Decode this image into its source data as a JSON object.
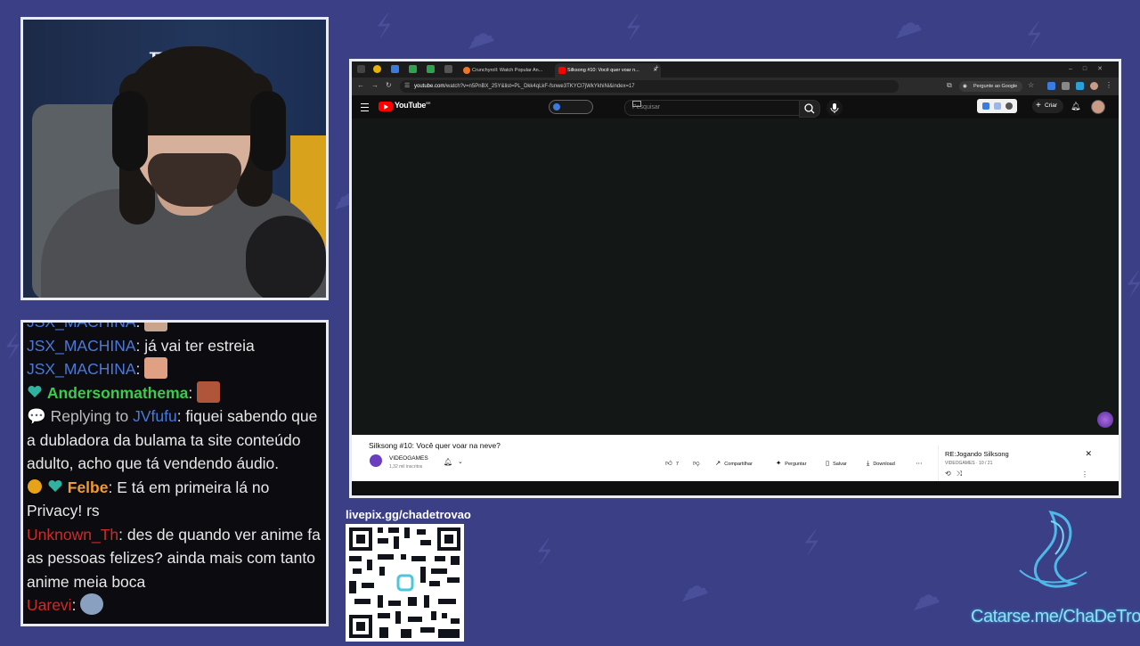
{
  "webcam": {
    "sign_text": "E: P"
  },
  "chat": {
    "lines": [
      {
        "user": "JSX_MACHINA",
        "text": ":"
      },
      {
        "user": "JSX_MACHINA",
        "text": ": já vai ter estreia"
      },
      {
        "user": "JSX_MACHINA",
        "text": ":"
      },
      {
        "user": "Andersonmathema",
        "text": ":"
      },
      {
        "reply_prefix": "Replying to ",
        "reply_user": "JVfufu",
        "text": ": fiquei sabendo que a dubladora da bulama ta site conteúdo adulto, acho que tá vendendo áudio."
      },
      {
        "user": "Felbe",
        "text": ": E tá em primeira lá no Privacy! rs"
      },
      {
        "user": "Unknown_Th",
        "text": ": des de quando ver anime fa as pessoas felizes? ainda mais com tanto anime meia boca"
      },
      {
        "user": "Uarevi",
        "text": ":"
      }
    ]
  },
  "livepix": {
    "label": "livepix.gg/chadetrovao"
  },
  "catarse": {
    "text": "Catarse.me/ChaDeTrovao"
  },
  "browser": {
    "tabs": [
      {
        "label": "Crunchyroll: Watch Popular An..."
      },
      {
        "label": "Silksong #10: Você quer voar n..."
      }
    ],
    "url_host": "youtube.com",
    "url_path": "/watch?v=n5PnBX_25Y&list=PL_Dkk4qLkF-fsnwe3TKYCl7jWkYkhiNi&index=17",
    "ask_google": "Pergunte ao Google",
    "youtube": {
      "logo_text": "YouTube",
      "logo_sup": "BR",
      "search_placeholder": "Pesquisar",
      "create_label": "Criar",
      "video_title": "Silksong #10: Você quer voar na neve?",
      "channel_name": "VIDEOGAMES",
      "channel_subs": "1,32 mil inscritos",
      "likes": "7",
      "share_label": "Compartilhar",
      "ask_label": "Perguntar",
      "save_label": "Salvar",
      "download_label": "Download",
      "playlist_title": "RE:Jogando Silksong",
      "playlist_sub": "VIDEOGAMES · 10 / 21"
    }
  },
  "colors": {
    "background": "#3b3f86",
    "border": "#e9ecf4",
    "youtube_red": "#ff0000"
  }
}
